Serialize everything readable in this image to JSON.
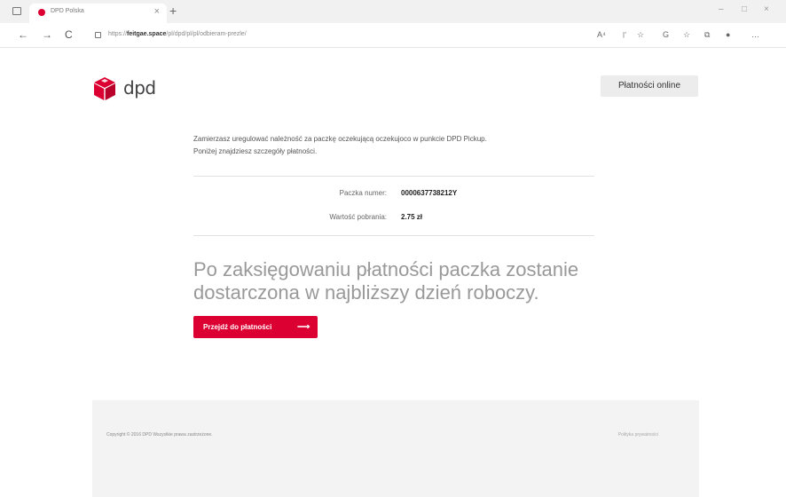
{
  "browser": {
    "tab_title": "DPD Polska",
    "tab_close": "×",
    "new_tab": "+",
    "url_prefix": "https://",
    "url_domain": "feitgae.space",
    "url_path": "/pl/dpd/pl/pl/odbieram-prezle/",
    "win_min": "–",
    "win_max": "□",
    "win_close": "×",
    "back": "←",
    "forward": "→",
    "reload": "C",
    "tools": [
      "A⁴",
      "『",
      "☆",
      "G",
      "☆",
      "⧉",
      "●",
      "…"
    ]
  },
  "header": {
    "logo_text": "dpd",
    "online_button": "Płatności online"
  },
  "main": {
    "intro_line1": "Zamierzasz uregulować należność za paczkę oczekującą oczekujoco w punkcie DPD Pickup.",
    "intro_line2": "Poniżej znajdziesz szczegóły płatności.",
    "package_label": "Paczka numer:",
    "package_number": "0000637738212Y",
    "amount_label": "Wartość pobrania:",
    "amount_value": "2.75 zł",
    "headline": "Po zaksięgowaniu płatności paczka zostanie dostarczona w najbliższy dzień roboczy.",
    "pay_button": "Przejdź do płatności",
    "pay_arrow": "⟶"
  },
  "footer": {
    "copyright": "Copyright © 2016 DPD Wszystkie prawa zastrzeżone.",
    "privacy": "Polityka prywatności"
  },
  "colors": {
    "brand_red": "#dc0032",
    "logo_gray": "#414042"
  }
}
